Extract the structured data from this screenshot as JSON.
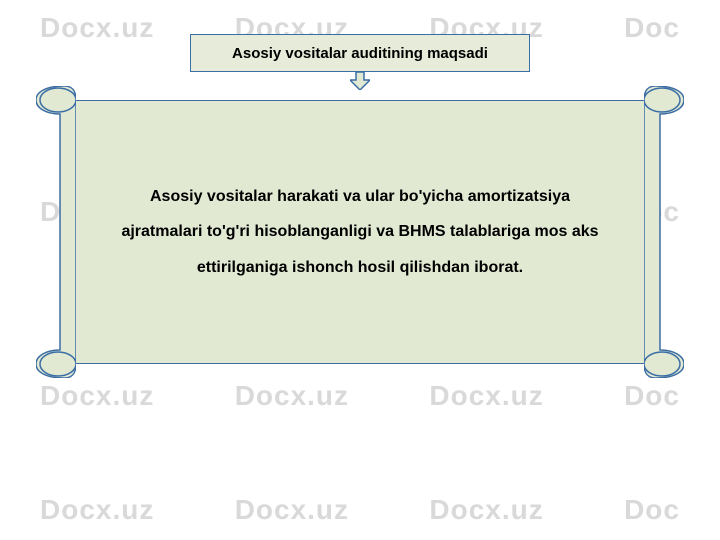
{
  "watermark": "Docx.uz",
  "title": "Asosiy vositalar auditining maqsadi",
  "body": "Asosiy vositalar harakati va ular bo'yicha amortizatsiya ajratmalari to'g'ri hisoblanganligi va BHMS talablariga mos aks ettirilganiga ishonch hosil qilishdan iborat.",
  "colors": {
    "fill": "#e2e9d3",
    "border": "#3b6ea5",
    "watermark": "#d9d9d9"
  }
}
